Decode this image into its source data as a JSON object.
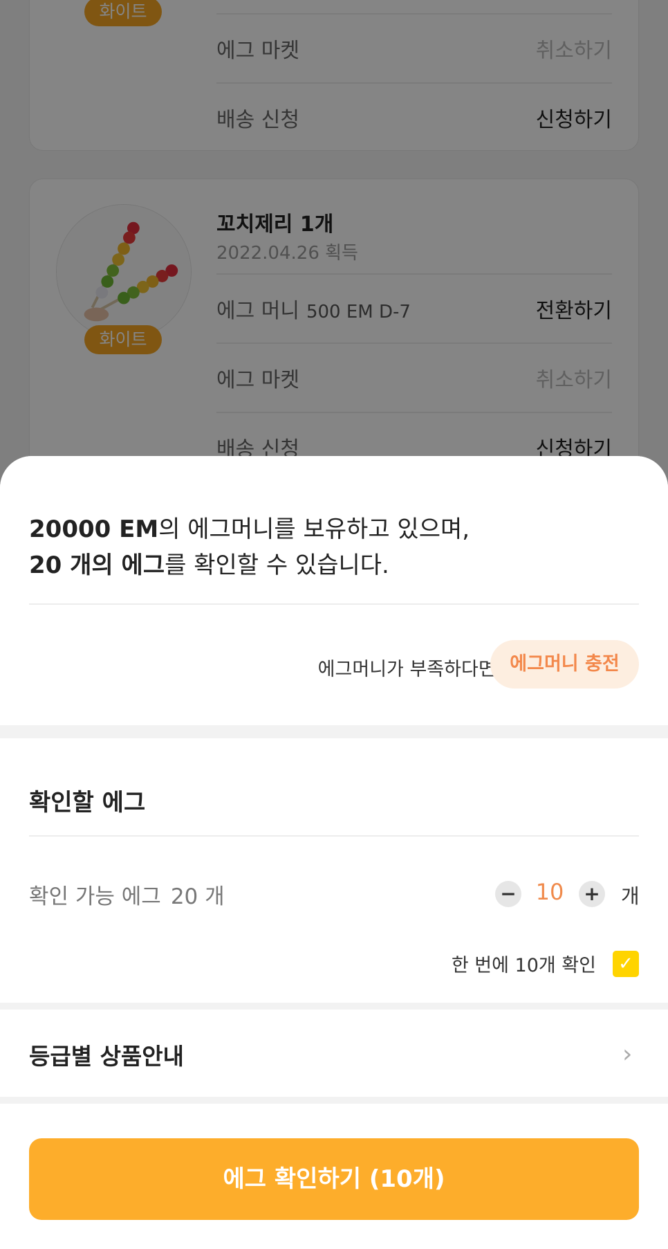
{
  "items": [
    {
      "grade": "화이트",
      "rows": [
        {
          "label": "에그 마켓",
          "action": "취소하기",
          "disabled": true
        },
        {
          "label": "배송 신청",
          "action": "신청하기",
          "disabled": false
        }
      ]
    },
    {
      "title": "꼬치제리 1개",
      "date": "2022.04.26 획득",
      "grade": "화이트",
      "rows": [
        {
          "label": "에그 머니",
          "sub": "500 EM  D-7",
          "action": "전환하기",
          "disabled": false
        },
        {
          "label": "에그 마켓",
          "action": "취소하기",
          "disabled": true
        },
        {
          "label": "배송 신청",
          "action": "신청하기",
          "disabled": false
        }
      ]
    }
  ],
  "sheet": {
    "balance_amount": "20000 EM",
    "balance_text": "의 에그머니를 보유하고 있으며,",
    "egg_count": "20 개의 에그",
    "egg_text": "를 확인할 수 있습니다.",
    "shortage_text": "에그머니가 부족하다면?",
    "charge_label": "에그머니 충전",
    "section_title": "확인할 에그",
    "available_label": "확인 가능 에그",
    "available_count": "20 개",
    "minus_label": "−",
    "quantity": "10",
    "plus_label": "+",
    "unit": "개",
    "batch_label": "한 번에 10개 확인",
    "batch_checked_mark": "✓",
    "grade_info_label": "등급별 상품안내",
    "chevron": "›",
    "confirm_label": "에그 확인하기 (10개)"
  },
  "colors": {
    "accent": "#fdad2b",
    "badge": "#f5a623",
    "charge_text": "#f3884b",
    "charge_bg": "#fdeee0",
    "checkbox": "#ffd400"
  },
  "icons": [
    "minus-icon",
    "plus-icon",
    "check-icon",
    "chevron-right-icon"
  ]
}
